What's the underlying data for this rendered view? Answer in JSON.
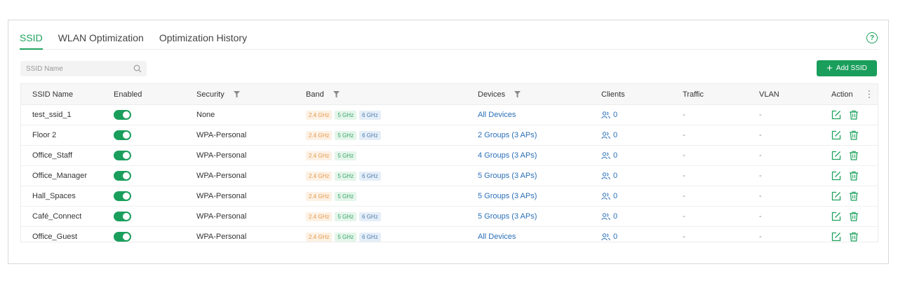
{
  "tabs": [
    {
      "label": "SSID"
    },
    {
      "label": "WLAN Optimization"
    },
    {
      "label": "Optimization History"
    }
  ],
  "help_symbol": "?",
  "search": {
    "placeholder": "SSID Name"
  },
  "add_button": {
    "label": "Add SSID"
  },
  "columns": {
    "name": "SSID Name",
    "enabled": "Enabled",
    "security": "Security",
    "band": "Band",
    "devices": "Devices",
    "clients": "Clients",
    "traffic": "Traffic",
    "vlan": "VLAN",
    "action": "Action"
  },
  "band_labels": {
    "b24": "2.4 GHz",
    "b5": "5 GHz",
    "b6": "6 GHz"
  },
  "rows": [
    {
      "name": "test_ssid_1",
      "security": "None",
      "devices": "All Devices",
      "clients": "0",
      "traffic": "-",
      "vlan": "-",
      "has6": true
    },
    {
      "name": "Floor 2",
      "security": "WPA-Personal",
      "devices": "2 Groups (3 APs)",
      "clients": "0",
      "traffic": "-",
      "vlan": "-",
      "has6": true
    },
    {
      "name": "Office_Staff",
      "security": "WPA-Personal",
      "devices": "4 Groups (3 APs)",
      "clients": "0",
      "traffic": "-",
      "vlan": "-",
      "has6": false
    },
    {
      "name": "Office_Manager",
      "security": "WPA-Personal",
      "devices": "5 Groups (3 APs)",
      "clients": "0",
      "traffic": "-",
      "vlan": "-",
      "has6": true
    },
    {
      "name": "Hall_Spaces",
      "security": "WPA-Personal",
      "devices": "5 Groups (3 APs)",
      "clients": "0",
      "traffic": "-",
      "vlan": "-",
      "has6": false
    },
    {
      "name": "Café_Connect",
      "security": "WPA-Personal",
      "devices": "5 Groups (3 APs)",
      "clients": "0",
      "traffic": "-",
      "vlan": "-",
      "has6": true
    },
    {
      "name": "Office_Guest",
      "security": "WPA-Personal",
      "devices": "All Devices",
      "clients": "0",
      "traffic": "-",
      "vlan": "-",
      "has6": true
    }
  ],
  "colors": {
    "accent": "#1a9e5c",
    "link": "#2a6fb7"
  }
}
